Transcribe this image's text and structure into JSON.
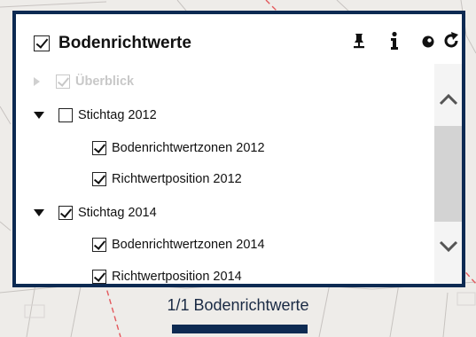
{
  "panel": {
    "title": "Bodenrichtwerte",
    "title_checked": true,
    "tools": [
      {
        "name": "pin-tool-icon",
        "glyph": "pin"
      },
      {
        "name": "info-icon",
        "glyph": "info"
      },
      {
        "name": "opacity-icon",
        "glyph": "drop"
      },
      {
        "name": "reload-icon",
        "glyph": "reload"
      }
    ]
  },
  "tree": {
    "overview_label": "Überblick",
    "groups": [
      {
        "label": "Stichtag 2012",
        "checked": false,
        "children": [
          {
            "label": "Bodenrichtwertzonen 2012",
            "checked": true
          },
          {
            "label": "Richtwertposition 2012",
            "checked": true
          }
        ]
      },
      {
        "label": "Stichtag 2014",
        "checked": true,
        "children": [
          {
            "label": "Bodenrichtwertzonen 2014",
            "checked": true
          },
          {
            "label": "Richtwertposition 2014",
            "checked": true
          }
        ]
      }
    ]
  },
  "footer": {
    "label": "1/1 Bodenrichtwerte"
  },
  "colors": {
    "panel_border": "#0d2a52",
    "disabled": "#c8c8c8"
  }
}
